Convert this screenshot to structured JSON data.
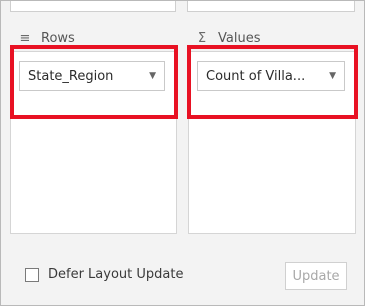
{
  "rows_panel": {
    "title": "Rows",
    "icon": "rows-icon",
    "fields": [
      {
        "label": "State_Region",
        "icon": "dropdown-arrow-icon"
      }
    ]
  },
  "values_panel": {
    "title": "Values",
    "icon": "sigma-icon",
    "fields": [
      {
        "label": "Count of Villa...",
        "icon": "dropdown-arrow-icon"
      }
    ]
  },
  "footer": {
    "defer_label": "Defer Layout Update",
    "defer_checked": false,
    "update_label": "Update"
  },
  "colors": {
    "highlight": "#e81123",
    "panel_bg": "#ffffff",
    "chrome_bg": "#f3f3f3"
  }
}
